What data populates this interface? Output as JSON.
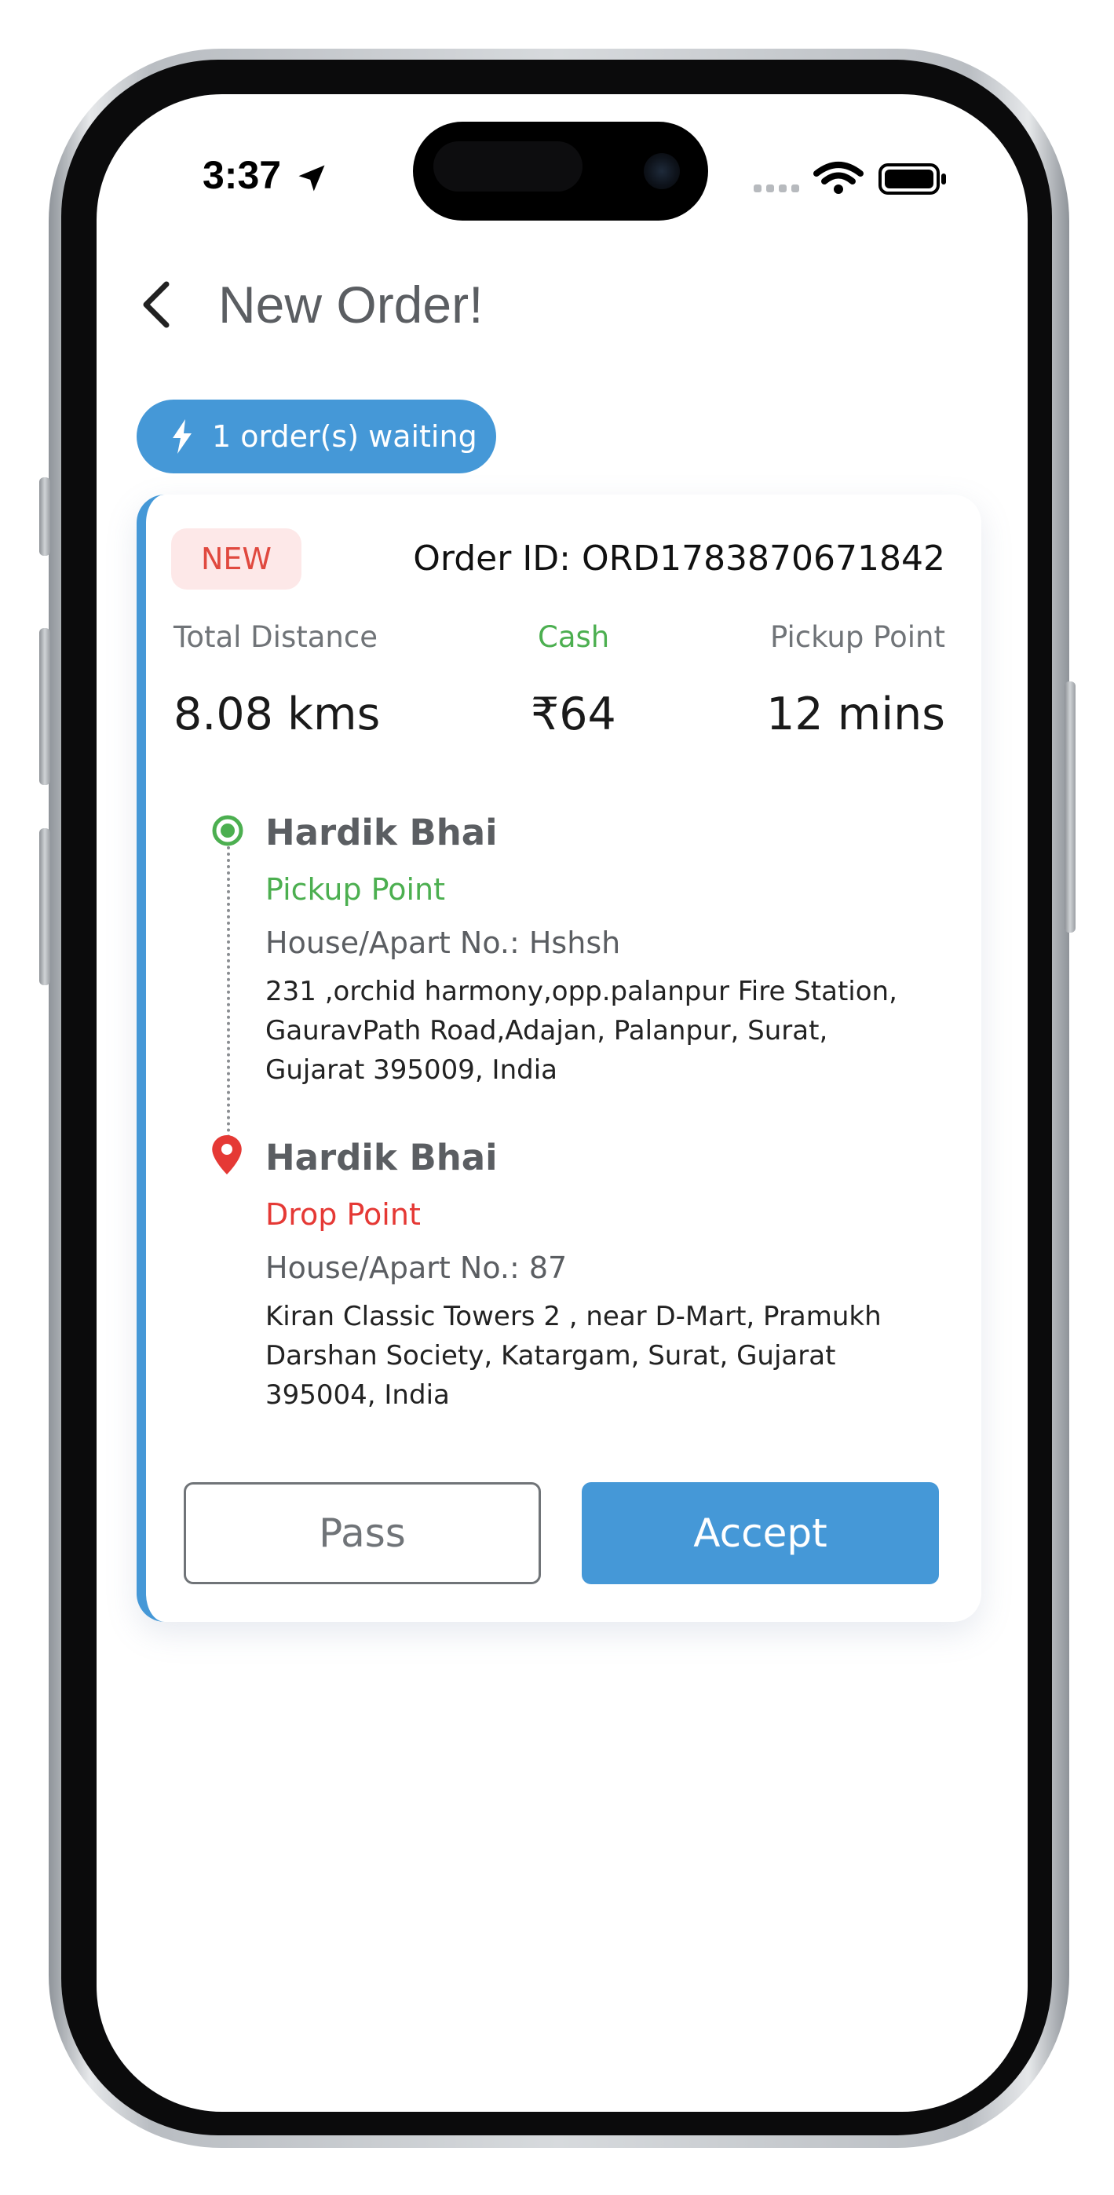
{
  "status_bar": {
    "time": "3:37"
  },
  "header": {
    "title": "New Order!"
  },
  "waiting_badge": {
    "text": "1 order(s) waiting"
  },
  "order": {
    "tag": "NEW",
    "order_id": "Order ID: ORD1783870671842",
    "stats": [
      {
        "label": "Total Distance",
        "value": "8.08 kms",
        "label_color": "#707478"
      },
      {
        "label": "Cash",
        "value": "₹64",
        "label_color": "#4caf50"
      },
      {
        "label": "Pickup Point",
        "value": "12 mins",
        "label_color": "#707478"
      }
    ],
    "pickup": {
      "name": "Hardik Bhai",
      "type": "Pickup Point",
      "house": "House/Apart No.: Hshsh",
      "address_lines": [
        "231 ,orchid harmony,opp.palanpur Fire Station,",
        "GauravPath Road,Adajan, Palanpur, Surat,",
        "Gujarat 395009, India"
      ],
      "color": "#4caf50"
    },
    "drop": {
      "name": "Hardik Bhai",
      "type": "Drop Point",
      "house": "House/Apart No.: 87",
      "address_lines": [
        "Kiran Classic Towers 2 , near D-Mart, Pramukh",
        "Darshan Society, Katargam, Surat, Gujarat",
        "395004, India"
      ],
      "color": "#e53935"
    }
  },
  "actions": {
    "pass_label": "Pass",
    "accept_label": "Accept"
  },
  "colors": {
    "accent": "#4598d7",
    "new_tag": "#e0493f",
    "pickup": "#4caf50",
    "drop": "#e53935"
  }
}
